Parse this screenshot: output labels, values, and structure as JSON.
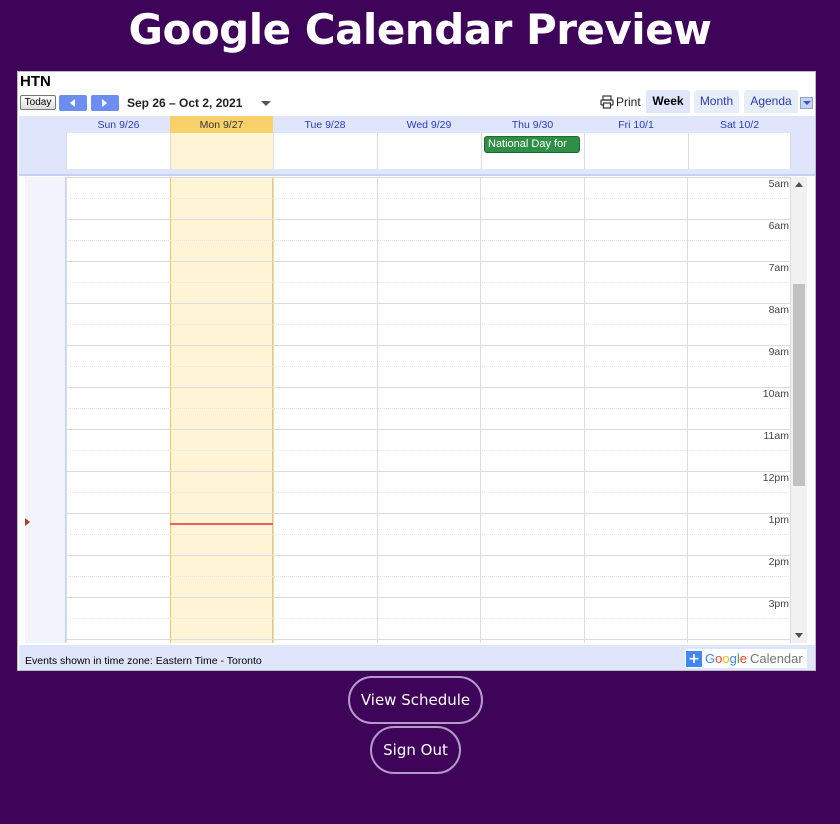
{
  "page": {
    "title": "Google Calendar Preview"
  },
  "calendar": {
    "name": "HTN",
    "today_label": "Today",
    "date_range": "Sep 26 – Oct 2, 2021",
    "print_label": "Print",
    "tabs": [
      {
        "label": "Week",
        "active": true
      },
      {
        "label": "Month",
        "active": false
      },
      {
        "label": "Agenda",
        "active": false
      }
    ],
    "days": [
      {
        "label": "Sun 9/26",
        "today": false
      },
      {
        "label": "Mon 9/27",
        "today": true
      },
      {
        "label": "Tue 9/28",
        "today": false
      },
      {
        "label": "Wed 9/29",
        "today": false
      },
      {
        "label": "Thu 9/30",
        "today": false
      },
      {
        "label": "Fri 10/1",
        "today": false
      },
      {
        "label": "Sat 10/2",
        "today": false
      }
    ],
    "all_day_event": {
      "day": "Thu 9/30",
      "title": "National Day for",
      "color": "#2f8f46"
    },
    "hours": [
      "5am",
      "6am",
      "7am",
      "8am",
      "9am",
      "10am",
      "11am",
      "12pm",
      "1pm",
      "2pm",
      "3pm"
    ],
    "current_time_hour": "1pm",
    "timezone_text": "Events shown in time zone: Eastern Time - Toronto",
    "badge": {
      "plus": "+",
      "google": "Google",
      "calendar": "Calendar"
    }
  },
  "buttons": {
    "view_schedule": "View Schedule",
    "sign_out": "Sign Out"
  },
  "colors": {
    "background": "#3e0459",
    "today": "#f9d16b",
    "accent": "#6d8ef0"
  }
}
